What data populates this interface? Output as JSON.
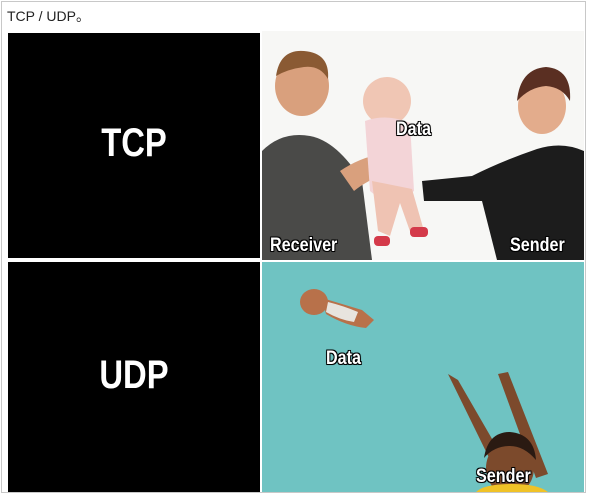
{
  "header": {
    "title": "TCP / UDP。"
  },
  "panels": {
    "tcp_label": "TCP",
    "udp_label": "UDP",
    "tcp_photo": {
      "data_caption": "Data",
      "receiver_caption": "Receiver",
      "sender_caption": "Sender"
    },
    "udp_photo": {
      "data_caption": "Data",
      "sender_caption": "Sender"
    }
  },
  "colors": {
    "label_bg": "#000000",
    "udp_bg": "#6fc3c2",
    "tcp_bg": "#f7f7f5"
  }
}
